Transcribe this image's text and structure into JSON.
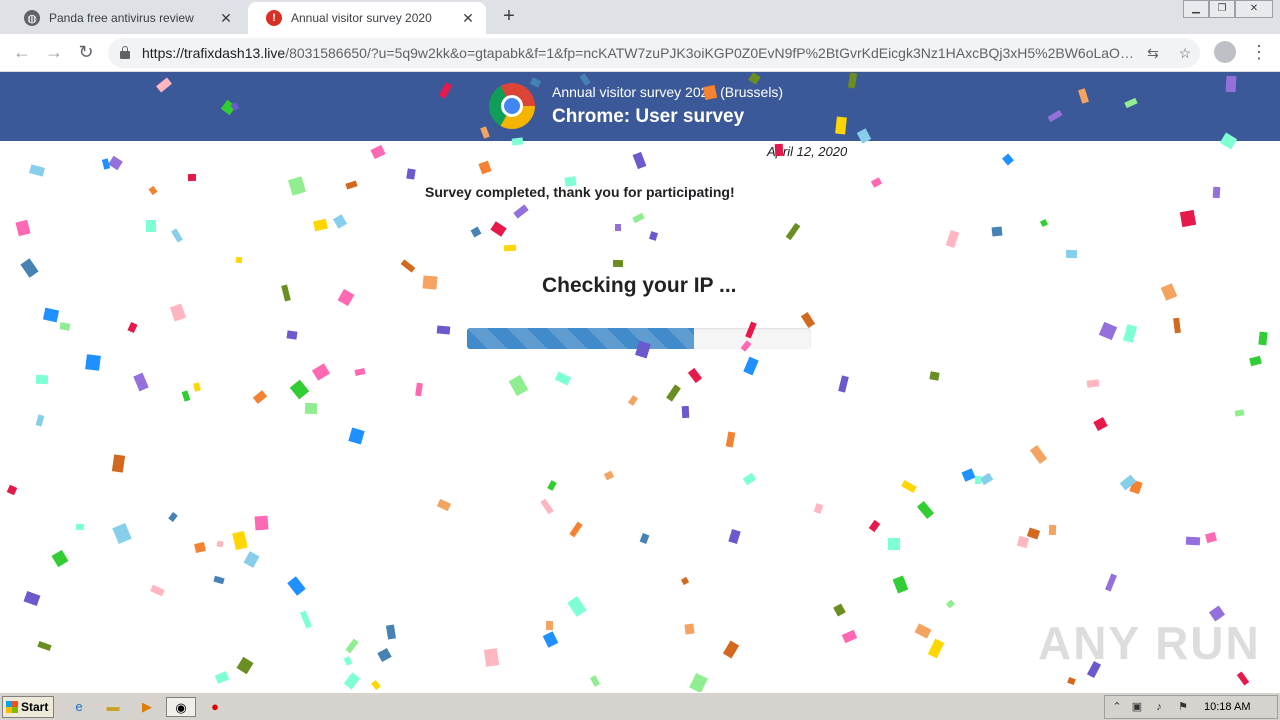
{
  "browser": {
    "tabs": [
      {
        "title": "Panda free antivirus review",
        "close": "✕",
        "favicon": "globe-icon"
      },
      {
        "title": "Annual visitor survey 2020",
        "close": "✕",
        "favicon": "alert-icon",
        "badge": "!"
      }
    ],
    "new_tab": "+",
    "url_host": "https://trafixdash13.live",
    "url_path": "/8031586650/?u=5q9w2kk&o=gtapabk&f=1&fp=ncKATW7zuPJK3oiKGP0Z0EvN9fP%2BtGvrKdEicgk3Nz1HAxcBQj3xH5%2BW6oLaO…"
  },
  "page": {
    "banner_subtitle": "Annual visitor survey 2020 (Brussels)",
    "banner_title": "Chrome: User survey",
    "date": "April 12, 2020",
    "completed_text": "Survey completed, thank you for participating!",
    "checking_text": "Checking your IP ...",
    "progress_percent": 66,
    "watermark": "ANY RUN"
  },
  "taskbar": {
    "start_label": "Start",
    "clock": "10:18 AM"
  },
  "colors": {
    "banner": "#3b5998",
    "progress": "#428bca"
  }
}
